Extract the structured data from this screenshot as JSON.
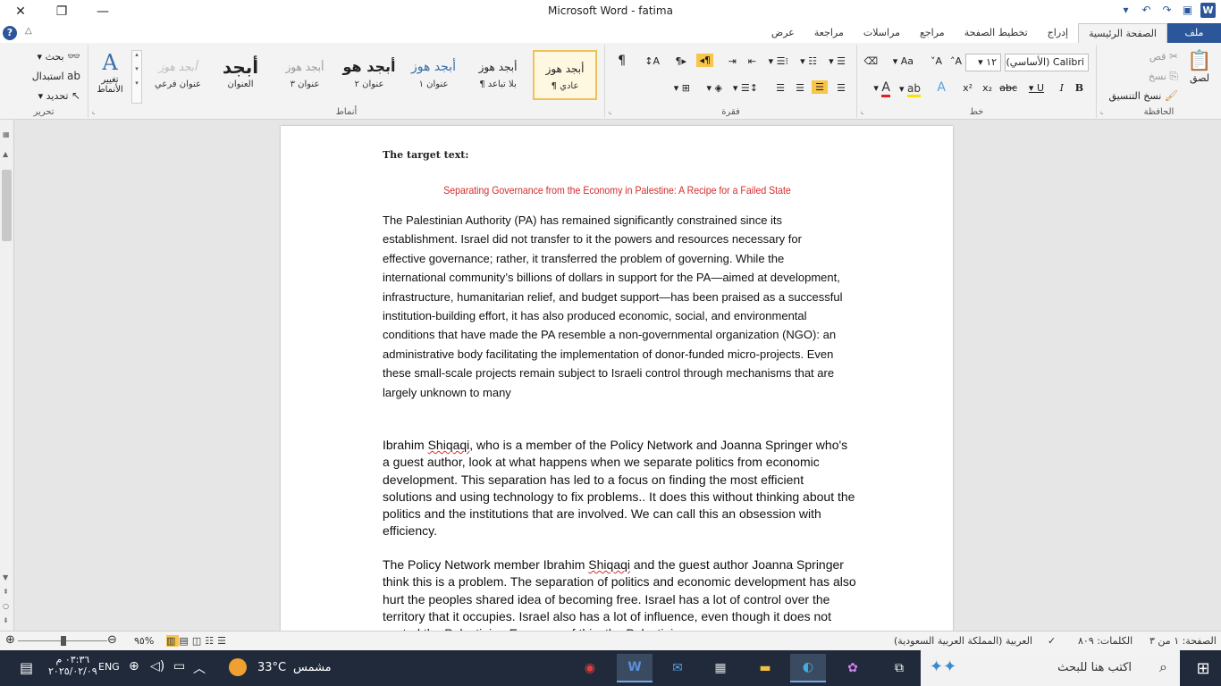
{
  "window": {
    "title": "Microsoft Word  -  fatima",
    "minimize_glyph": "—",
    "restore_glyph": "❐",
    "close_glyph": "✕"
  },
  "tabs": [
    {
      "label": "ملف",
      "type": "file"
    },
    {
      "label": "الصفحة الرئيسية",
      "type": "active"
    },
    {
      "label": "إدراج"
    },
    {
      "label": "تخطيط الصفحة"
    },
    {
      "label": "مراجع"
    },
    {
      "label": "مراسلات"
    },
    {
      "label": "مراجعة"
    },
    {
      "label": "عرض"
    }
  ],
  "help_glyph": "?",
  "collapse_glyph": "△",
  "ribbon": {
    "clipboard": {
      "group_label": "الحافظة",
      "paste": "لصق",
      "cut": "قص",
      "copy": "نسخ",
      "format_painter": "نسخ التنسيق"
    },
    "font": {
      "group_label": "خط",
      "font_name": "Calibri (الأساسي)",
      "font_size": "١٢",
      "bold": "B",
      "italic": "I",
      "underline": "U",
      "strike": "abc",
      "subscript": "x₂",
      "superscript": "x²",
      "grow": "A˄",
      "shrink": "A˅",
      "change_case": "Aa"
    },
    "paragraph": {
      "group_label": "فقرة"
    },
    "styles": {
      "group_label": "أنماط",
      "items": [
        {
          "preview": "أبجد هوز",
          "name": "¶ عادي"
        },
        {
          "preview": "أبجد هوز",
          "name": "¶ بلا تباعد"
        },
        {
          "preview": "أبجد هوز",
          "name": "عنوان ١"
        },
        {
          "preview": "أبجد هو",
          "name": "عنوان ٢"
        },
        {
          "preview": "أبجد هوز",
          "name": "عنوان ٣"
        },
        {
          "preview": "أبجد",
          "name": "العنوان"
        },
        {
          "preview": "أبجد هوز",
          "name": "عنوان فرعي"
        }
      ],
      "change_styles": "تغيير الأنماط"
    },
    "editing": {
      "group_label": "تحرير",
      "find": "بحث",
      "replace": "استبدال",
      "select": "تحديد"
    }
  },
  "document": {
    "target_label": "The target text:",
    "heading": "Separating Governance from the Economy in Palestine: A Recipe for a Failed State",
    "paragraph1": "The Palestinian Authority (PA) has remained significantly constrained since its establishment. Israel did not transfer to it the powers and resources necessary for effective governance; rather, it transferred the problem of governing. While the international community’s billions of dollars in support for the PA—aimed at development, infrastructure, humanitarian relief, and budget support—has been praised as a successful institution-building effort, it has also produced economic, social, and environmental conditions that have made the PA resemble a non-governmental organization (NGO): an administrative body facilitating the implementation of donor-funded micro-projects. Even these small-scale projects remain subject to Israeli control through mechanisms that are largely unknown to many",
    "paragraph2_a": "Ibrahim ",
    "paragraph2_b": "Shiqaqi",
    "paragraph2_c": ", who is a member of the Policy Network and Joanna Springer who's a guest author, look at what happens when we separate politics from economic development. This separation has led to a focus on finding the most efficient solutions and using technology to fix problems.. It does this without thinking about the politics and the institutions that are involved. We can call this an obsession with efficiency.",
    "paragraph3_a": "The Policy Network member Ibrahim ",
    "paragraph3_b": "Shiqaqi",
    "paragraph3_c": " and the guest author Joanna Springer think this is a problem. The separation of politics and economic development has also hurt the peoples shared idea of becoming free. Israel has a lot of control over the territory that it occupies. Israel also has a lot of influence, even though it does not control the Palestinian Economy of this, the Palestinian"
  },
  "statusbar": {
    "page": "الصفحة: ١ من ٣",
    "words": "الكلمات: ٨٠٩",
    "language": "العربية (المملكة العربية السعودية)",
    "zoom": "%٩٥"
  },
  "taskbar": {
    "search_placeholder": "اكتب هنا للبحث",
    "weather_temp": "33°C",
    "weather_label": "مشمس",
    "time": "٠٣:٣٦ م",
    "date": "٢٠٢٥/٠٢/٠٩",
    "lang": "ENG"
  }
}
